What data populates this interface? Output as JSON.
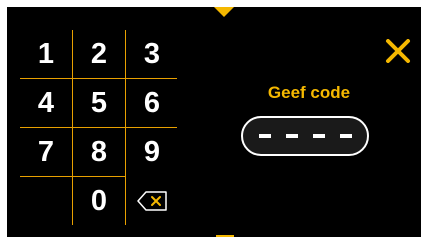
{
  "keypad": {
    "keys": [
      "1",
      "2",
      "3",
      "4",
      "5",
      "6",
      "7",
      "8",
      "9",
      "0"
    ],
    "backspace_icon": "backspace-icon"
  },
  "code_entry": {
    "label": "Geef code",
    "digits_entered": 0,
    "slots": 4
  },
  "close_icon": "close-icon",
  "colors": {
    "accent": "#f5b800",
    "background": "#000000",
    "text": "#ffffff"
  }
}
